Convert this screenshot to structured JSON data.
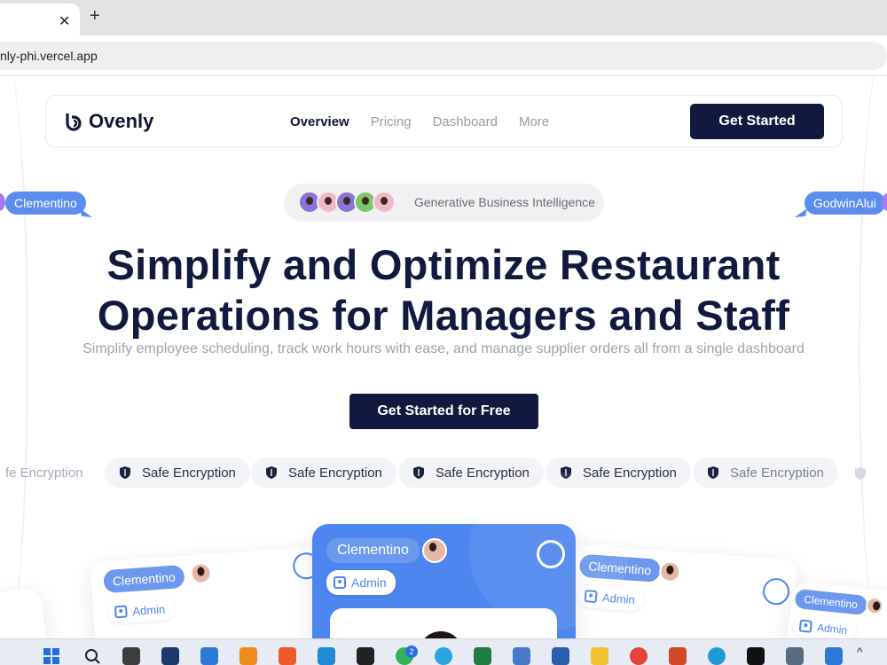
{
  "browser": {
    "url": "nly-phi.vercel.app",
    "close_label": "✕",
    "new_tab_label": "+"
  },
  "nav": {
    "brand": "Ovenly",
    "links": [
      {
        "label": "Overview",
        "active": true
      },
      {
        "label": "Pricing"
      },
      {
        "label": "Dashboard"
      },
      {
        "label": "More"
      }
    ],
    "cta": "Get Started"
  },
  "floating_users": {
    "left": "Clementino",
    "right": "GodwinAlui"
  },
  "badge": {
    "text": "Generative Business Intelligence",
    "avatar_colors": [
      "#8c73d8",
      "#f0b9c8",
      "#8c73d8",
      "#7fc46a",
      "#f0b9c8"
    ]
  },
  "hero": {
    "title_line1": "Simplify and Optimize Restaurant",
    "title_line2": "Operations for Managers and Staff",
    "subtitle": "Simplify employee scheduling, track work hours with ease, and manage supplier orders all from a single dashboard",
    "cta": "Get Started for Free"
  },
  "marquee": {
    "partial_left": "fe Encryption",
    "chip_label": "Safe Encryption"
  },
  "cards": {
    "left_name": "Clementino",
    "left_role": "Admin",
    "main_name": "Clementino",
    "main_role": "Admin",
    "right_name": "Clementino",
    "right_role": "Admin",
    "far_right_name": "Clementino",
    "far_right_role": "Admin"
  },
  "taskbar": {
    "notification_count": "2",
    "icons": [
      "windows-start",
      "search",
      "task-view",
      "widgets",
      "store",
      "vlc",
      "brave",
      "vscode",
      "terminal",
      "whatsapp",
      "telegram",
      "excel",
      "notes",
      "word",
      "files",
      "chrome",
      "powerpoint",
      "edge",
      "capcut",
      "calculator",
      "app"
    ]
  },
  "colors": {
    "brand_navy": "#111a3e",
    "accent_blue": "#4d86ee"
  }
}
